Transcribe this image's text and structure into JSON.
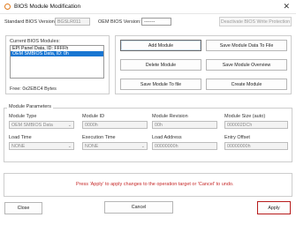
{
  "window": {
    "title": "BIOS Module Modification",
    "close_glyph": "✕"
  },
  "header": {
    "standard_bios_version_label": "Standard BIOS Version:",
    "standard_bios_version_value": "BGSLR011",
    "oem_bios_version_label": "OEM BIOS Version:",
    "oem_bios_version_value": "-------",
    "deactivate_button": "Deactivate BIOS Write Protection"
  },
  "modules": {
    "list_label": "Current BIOS Modules:",
    "items": [
      "EPI Panel Data, ID: FFFFh",
      "OEM SMBIOS Data, ID: 0h"
    ],
    "selected_index": 1,
    "free_label": "Free: 0x2EBC4 Bytes"
  },
  "actions": {
    "add_module": "Add Module",
    "save_module_data": "Save Module Data To File",
    "delete_module": "Delete Module",
    "save_module_overview": "Save Module Overview",
    "save_module_to_file": "Save Module To file",
    "create_module": "Create Module"
  },
  "params": {
    "group_title": "Module Parameters",
    "module_type_label": "Module Type",
    "module_type_value": "OEM SMBIOS Data",
    "module_id_label": "Module ID",
    "module_id_value": "0000h",
    "module_revision_label": "Module Revision",
    "module_revision_value": "00h",
    "module_size_label": "Module Size (auto)",
    "module_size_value": "000002DCh",
    "load_time_label": "Load Time",
    "load_time_value": "NONE",
    "execution_time_label": "Execution Time",
    "execution_time_value": "NONE",
    "load_address_label": "Load Address",
    "load_address_value": "00000000h",
    "entry_offset_label": "Entry Offset",
    "entry_offset_value": "00000000h"
  },
  "status": {
    "message": "Press 'Apply' to apply changes to the operation target or 'Cancel' to undo."
  },
  "footer": {
    "close": "Close",
    "cancel": "Cancel",
    "apply": "Apply"
  },
  "colors": {
    "accent": "#1976d2",
    "status": "#c62828",
    "apply_border": "#b71c1c",
    "icon": "#e07a1c"
  },
  "icons": {
    "app": "bios-app-icon",
    "close": "close-icon",
    "dropdown": "chevron-down-icon"
  }
}
